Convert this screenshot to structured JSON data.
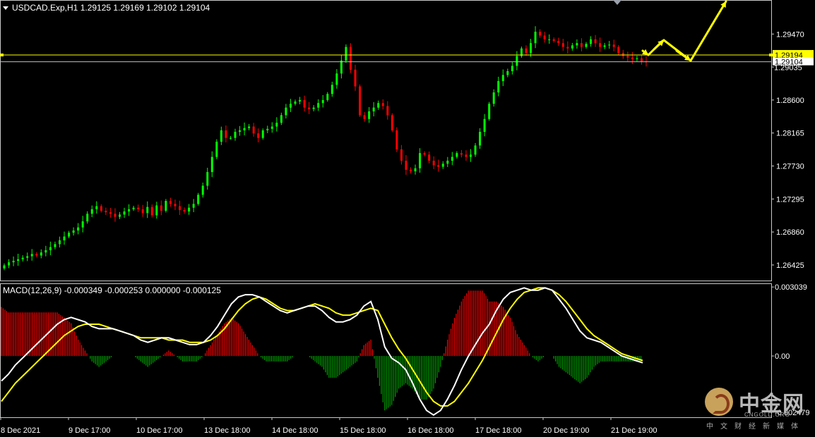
{
  "main": {
    "header": "USDCAD.Exp,H1  1.29125 1.29169 1.29102 1.29104",
    "current_price_label": "1.29194",
    "bid_label": "1.29104",
    "hidden_label": "1.29035"
  },
  "macd": {
    "header": "MACD(12,26,9) -0.000349 -0.000253 0.000000 -0.000125"
  },
  "watermark": {
    "name": "中金网",
    "domain": "CNGOLD.ORG",
    "slogan": "中文财经新媒体"
  },
  "colors": {
    "bull": "#00ff00",
    "bear": "#ff0000",
    "macd_pos": "#ff0000",
    "macd_neg": "#00a000",
    "macd_line": "#ffffff",
    "signal_line": "#ffff00",
    "price_line": "#ffff00",
    "bid_line": "#c0c0c0",
    "arrow": "#ffff00"
  },
  "chart_data": [
    {
      "type": "candlestick",
      "title": "USDCAD.Exp,H1",
      "ylim": [
        1.2622,
        1.299
      ],
      "y_ticks": [
        1.26425,
        1.2686,
        1.27295,
        1.2773,
        1.28165,
        1.286,
        1.29035,
        1.2947
      ],
      "y_tick_labels": [
        "1.26425",
        "1.26860",
        "1.27295",
        "1.27730",
        "1.28165",
        "1.28600",
        "",
        "1.29470"
      ],
      "current_price": 1.29194,
      "bid_price": 1.29104,
      "x_tick_labels": [
        "8 Dec 2021",
        "9 Dec 17:00",
        "10 Dec 17:00",
        "13 Dec 18:00",
        "14 Dec 18:00",
        "15 Dec 18:00",
        "16 Dec 18:00",
        "17 Dec 18:00",
        "20 Dec 19:00",
        "21 Dec 19:00"
      ],
      "closes": [
        1.2642,
        1.2646,
        1.2648,
        1.265,
        1.2652,
        1.2654,
        1.2657,
        1.2655,
        1.2659,
        1.2662,
        1.2666,
        1.267,
        1.2675,
        1.268,
        1.2685,
        1.2688,
        1.2692,
        1.27,
        1.271,
        1.2716,
        1.272,
        1.2714,
        1.2712,
        1.271,
        1.2706,
        1.2709,
        1.2713,
        1.2716,
        1.2718,
        1.2716,
        1.2711,
        1.2719,
        1.2708,
        1.2721,
        1.2714,
        1.2727,
        1.2723,
        1.272,
        1.2715,
        1.2713,
        1.2718,
        1.2723,
        1.2735,
        1.2747,
        1.2765,
        1.2785,
        1.2805,
        1.282,
        1.281,
        1.281,
        1.2818,
        1.282,
        1.2823,
        1.2825,
        1.2816,
        1.281,
        1.282,
        1.2822,
        1.2825,
        1.283,
        1.284,
        1.285,
        1.2855,
        1.2858,
        1.286,
        1.285,
        1.2848,
        1.285,
        1.2856,
        1.286,
        1.2868,
        1.288,
        1.2895,
        1.2912,
        1.293,
        1.29,
        1.2878,
        1.284,
        1.2835,
        1.2845,
        1.285,
        1.2856,
        1.2852,
        1.284,
        1.282,
        1.2795,
        1.278,
        1.2768,
        1.2766,
        1.277,
        1.279,
        1.2788,
        1.278,
        1.2774,
        1.2772,
        1.2776,
        1.278,
        1.2785,
        1.279,
        1.2788,
        1.2785,
        1.2788,
        1.28,
        1.2818,
        1.2835,
        1.2855,
        1.287,
        1.2885,
        1.2893,
        1.2898,
        1.2905,
        1.2918,
        1.2928,
        1.2922,
        1.2935,
        1.295,
        1.2945,
        1.294,
        1.294,
        1.2938,
        1.2935,
        1.293,
        1.2928,
        1.2932,
        1.2935,
        1.293,
        1.2934,
        1.294,
        1.2935,
        1.293,
        1.2932,
        1.2933,
        1.293,
        1.2922,
        1.2918,
        1.2916,
        1.2914,
        1.2915,
        1.2911,
        1.291
      ]
    },
    {
      "type": "macd",
      "title": "MACD(12,26,9)",
      "ylim": [
        -0.0027,
        0.0032
      ],
      "y_ticks": [
        0.003039,
        0.0,
        -0.002479
      ],
      "y_tick_labels": [
        "0.003039",
        "0.00",
        "-0.002479"
      ],
      "macd": [
        -0.0011,
        -0.0008,
        -0.0004,
        -0.0001,
        0.0002,
        0.0005,
        0.0008,
        0.0011,
        0.0014,
        0.0016,
        0.0017,
        0.0016,
        0.0015,
        0.0013,
        0.0012,
        0.0012,
        0.0012,
        0.0011,
        0.001,
        0.0009,
        0.0007,
        0.0006,
        0.0007,
        0.0008,
        0.0008,
        0.0007,
        0.0006,
        0.0005,
        0.0005,
        0.0006,
        0.0009,
        0.0013,
        0.0018,
        0.0023,
        0.0026,
        0.0027,
        0.0027,
        0.0026,
        0.0024,
        0.0022,
        0.002,
        0.0019,
        0.002,
        0.0021,
        0.0022,
        0.0022,
        0.002,
        0.0017,
        0.0015,
        0.0015,
        0.0016,
        0.0018,
        0.0022,
        0.0024,
        0.0016,
        0.0004,
        -0.0001,
        -0.0003,
        -0.0006,
        -0.0012,
        -0.0019,
        -0.0024,
        -0.0026,
        -0.0024,
        -0.0019,
        -0.0013,
        -0.0006,
        0.0,
        0.0005,
        0.001,
        0.0014,
        0.002,
        0.0025,
        0.0028,
        0.0029,
        0.003,
        0.0029,
        0.0029,
        0.003,
        0.0029,
        0.0025,
        0.0021,
        0.0016,
        0.0011,
        0.0008,
        0.0007,
        0.0006,
        0.0004,
        0.0002,
        0.0,
        -0.0001,
        -0.0002,
        -0.0003
      ],
      "signal": [
        -0.002,
        -0.0016,
        -0.0012,
        -0.0009,
        -0.0006,
        -0.0003,
        0.0,
        0.0003,
        0.0006,
        0.0009,
        0.0011,
        0.0013,
        0.0014,
        0.0014,
        0.0014,
        0.0013,
        0.0012,
        0.0011,
        0.001,
        0.0009,
        0.0008,
        0.0008,
        0.0008,
        0.0008,
        0.0007,
        0.0007,
        0.0007,
        0.0006,
        0.0006,
        0.0006,
        0.0007,
        0.0009,
        0.0012,
        0.0016,
        0.002,
        0.0023,
        0.0025,
        0.0026,
        0.0025,
        0.0023,
        0.0021,
        0.002,
        0.002,
        0.0021,
        0.0022,
        0.0023,
        0.0022,
        0.0021,
        0.0019,
        0.0018,
        0.0018,
        0.0019,
        0.002,
        0.0021,
        0.002,
        0.0014,
        0.0008,
        0.0003,
        -0.0001,
        -0.0006,
        -0.0011,
        -0.0016,
        -0.002,
        -0.0022,
        -0.0022,
        -0.002,
        -0.0016,
        -0.0012,
        -0.0007,
        -0.0002,
        0.0004,
        0.001,
        0.0016,
        0.0021,
        0.0025,
        0.0028,
        0.0029,
        0.003,
        0.003,
        0.0029,
        0.0027,
        0.0024,
        0.002,
        0.0016,
        0.0012,
        0.0009,
        0.0007,
        0.0005,
        0.0003,
        0.0001,
        0.0,
        -0.0001,
        -0.0002
      ]
    }
  ]
}
